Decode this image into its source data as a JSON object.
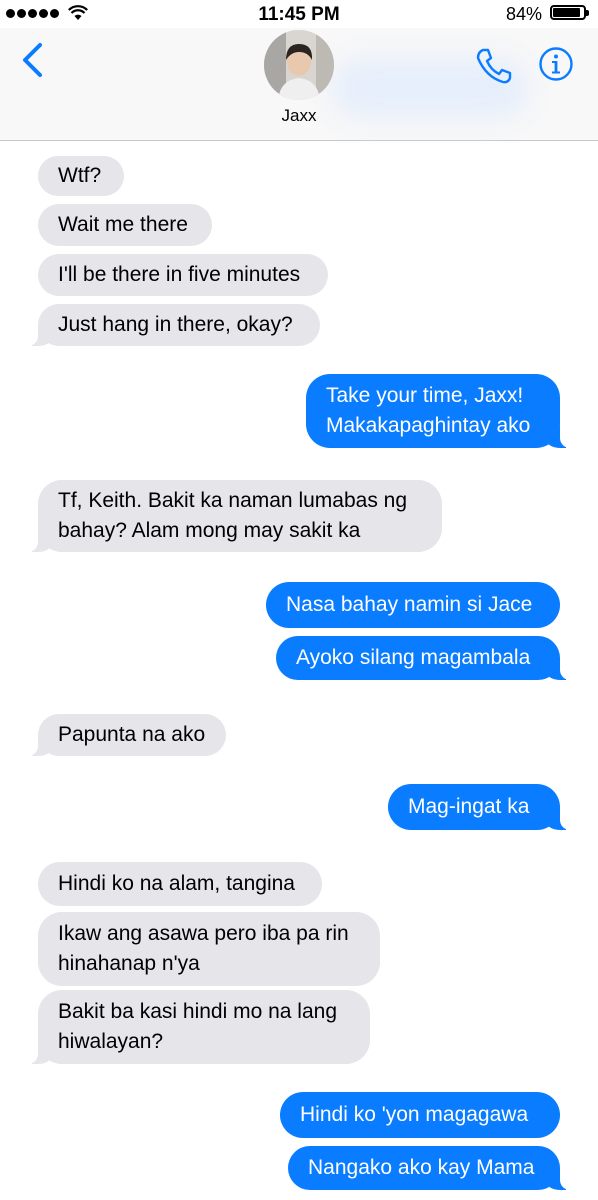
{
  "status_bar": {
    "time": "11:45 PM",
    "battery_percent": "84%",
    "battery_level": 0.84,
    "signal_bars": 5
  },
  "header": {
    "contact_name": "Jaxx",
    "accent_color": "#0a7cff",
    "icons": [
      "back-chevron-icon",
      "phone-icon",
      "info-icon"
    ]
  },
  "messages": [
    {
      "from": "them",
      "text": "Wtf?"
    },
    {
      "from": "them",
      "text": "Wait me there"
    },
    {
      "from": "them",
      "text": "I'll be there in five minutes"
    },
    {
      "from": "them",
      "text": "Just hang in there, okay?"
    },
    {
      "from": "me",
      "text": "Take your time, Jaxx!\nMakakapaghintay ako"
    },
    {
      "from": "them",
      "text": "Tf, Keith. Bakit ka naman lumabas ng\nbahay? Alam mong may sakit ka"
    },
    {
      "from": "me",
      "text": "Nasa bahay namin si Jace"
    },
    {
      "from": "me",
      "text": "Ayoko silang magambala"
    },
    {
      "from": "them",
      "text": "Papunta na ako"
    },
    {
      "from": "me",
      "text": "Mag-ingat ka"
    },
    {
      "from": "them",
      "text": "Hindi ko na alam, tangina"
    },
    {
      "from": "them",
      "text": "Ikaw ang asawa pero iba pa rin\nhinahanap n'ya"
    },
    {
      "from": "them",
      "text": "Bakit ba kasi hindi mo na lang\nhiwalayan?"
    },
    {
      "from": "me",
      "text": "Hindi ko 'yon magagawa"
    },
    {
      "from": "me",
      "text": "Nangako ako kay Mama"
    }
  ],
  "colors": {
    "incoming_bubble": "#e5e5ea",
    "outgoing_bubble": "#0a7cff"
  }
}
